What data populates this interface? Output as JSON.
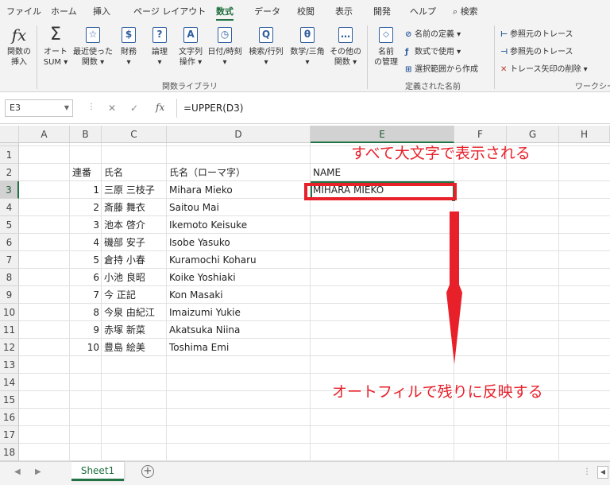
{
  "menu": {
    "items": [
      "ファイル",
      "ホーム",
      "挿入",
      "ページ レイアウト",
      "数式",
      "データ",
      "校閲",
      "表示",
      "開発",
      "ヘルプ"
    ],
    "active": "数式",
    "search_label": "検索"
  },
  "ribbon": {
    "insert_function": {
      "icon": "fx",
      "label1": "関数の",
      "label2": "挿入"
    },
    "library_buttons": [
      {
        "icon": "Σ",
        "label1": "オート",
        "label2": "SUM ▾"
      },
      {
        "icon": "☆",
        "label1": "最近使った",
        "label2": "関数 ▾"
      },
      {
        "icon": "$",
        "label1": "財務",
        "label2": "▾"
      },
      {
        "icon": "?",
        "label1": "論理",
        "label2": "▾"
      },
      {
        "icon": "A",
        "label1": "文字列",
        "label2": "操作 ▾"
      },
      {
        "icon": "◷",
        "label1": "日付/時刻",
        "label2": "▾"
      },
      {
        "icon": "Q",
        "label1": "検索/行列",
        "label2": "▾"
      },
      {
        "icon": "θ",
        "label1": "数学/三角",
        "label2": "▾"
      },
      {
        "icon": "…",
        "label1": "その他の",
        "label2": "関数 ▾"
      }
    ],
    "library_group": "関数ライブラリ",
    "name_manager": {
      "label1": "名前",
      "label2": "の管理"
    },
    "names_items": [
      {
        "icon": "⊘",
        "label": "名前の定義 ▾"
      },
      {
        "icon": "ƒ",
        "label": "数式で使用 ▾"
      },
      {
        "icon": "⊞",
        "label": "選択範囲から作成"
      }
    ],
    "names_group": "定義された名前",
    "audit_items": [
      {
        "icon": "⊢",
        "label": "参照元のトレース"
      },
      {
        "icon": "⊣",
        "label": "参照先のトレース"
      },
      {
        "icon": "✕",
        "label": "トレース矢印の削除 ▾"
      }
    ],
    "audit_group": "ワークシー"
  },
  "formula_bar": {
    "name_box": "E3",
    "fx": "fx",
    "formula": "=UPPER(D3)"
  },
  "columns": [
    "A",
    "B",
    "C",
    "D",
    "E",
    "F",
    "G",
    "H"
  ],
  "rows": [
    "1",
    "2",
    "3",
    "4",
    "5",
    "6",
    "7",
    "8",
    "9",
    "10",
    "11",
    "12",
    "13",
    "14",
    "15",
    "16",
    "17",
    "18"
  ],
  "header_row": {
    "b": "連番",
    "c": "氏名",
    "d": "氏名（ローマ字）",
    "e": "NAME"
  },
  "data_rows": [
    {
      "no": "1",
      "name": "三原 三枝子",
      "romaji": "Mihara Mieko",
      "upper": "MIHARA MIEKO"
    },
    {
      "no": "2",
      "name": "斎藤 舞衣",
      "romaji": "Saitou Mai",
      "upper": ""
    },
    {
      "no": "3",
      "name": "池本 啓介",
      "romaji": "Ikemoto Keisuke",
      "upper": ""
    },
    {
      "no": "4",
      "name": "磯部 安子",
      "romaji": "Isobe Yasuko",
      "upper": ""
    },
    {
      "no": "5",
      "name": "倉持 小春",
      "romaji": "Kuramochi Koharu",
      "upper": ""
    },
    {
      "no": "6",
      "name": "小池 良昭",
      "romaji": "Koike Yoshiaki",
      "upper": ""
    },
    {
      "no": "7",
      "name": "今 正記",
      "romaji": "Kon Masaki",
      "upper": ""
    },
    {
      "no": "8",
      "name": "今泉 由紀江",
      "romaji": "Imaizumi Yukie",
      "upper": ""
    },
    {
      "no": "9",
      "name": "赤塚 新菜",
      "romaji": "Akatsuka Niina",
      "upper": ""
    },
    {
      "no": "10",
      "name": "豊島 絵美",
      "romaji": "Toshima Emi",
      "upper": ""
    }
  ],
  "annotations": {
    "top": "すべて大文字で表示される",
    "bottom": "オートフィルで残りに反映する",
    "color": "#e8202a"
  },
  "sheet_tab": "Sheet1",
  "accent_color": "#217346"
}
